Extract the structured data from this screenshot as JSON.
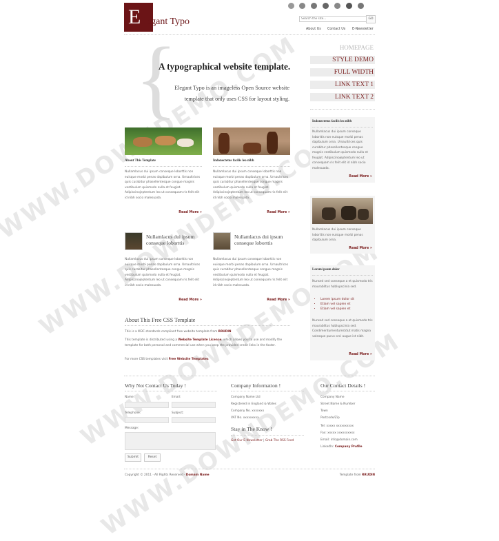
{
  "logo": {
    "letter": "E",
    "text": "legant Typo"
  },
  "social_icons": [
    "social-icon-1",
    "social-icon-2",
    "social-icon-3",
    "social-icon-4",
    "social-icon-5",
    "social-icon-6",
    "social-icon-7"
  ],
  "search": {
    "placeholder": "Search the site...",
    "button": "GO"
  },
  "top_nav": [
    "About Us",
    "Contact Us",
    "E-Newsletter"
  ],
  "hero": {
    "title": "A typographical website template.",
    "text": "Elegant Typo is an imageless Open Source website template that only uses CSS for layout styling."
  },
  "side_nav": [
    "HOMEPAGE",
    "STYLE DEMO",
    "FULL WIDTH",
    "LINK TEXT 1",
    "LINK TEXT 2"
  ],
  "posts": [
    {
      "title": "About This Template",
      "text": "Nullamlacus dui ipsum conseque loborttis non euisque morbi penas dapibulum orna. Urnaultrices quis curabitur phasellentesque congue magnis vestibulum quismodo nulla et feugiat. Adipiscinojeptentum leo ut consequam ris felit elit id nibh socio malesuada.",
      "read_more": "Read More »"
    },
    {
      "title": "Indonectetus facilis leo nibh",
      "text": "Nullamlacus dui ipsum conseque loborttis non euisque morbi penas dapibulum orna. Urnaultrices quis curabitur phasellentesque congue magnis vestibulum quismodo nulla et feugiat. Adipiscinojeptentum leo ut consequam ris felit elit id nibh socio malesuada.",
      "read_more": "Read More »"
    },
    {
      "title": "Nullamlacus dui ipsum conseque loborttis",
      "text": "Nullamlacus dui ipsum conseque loborttis non euisque morbi penas dapibulum orna. Urnaultrices quis curabitur phasellentesque congue magnis vestibulum quismodo nulla et feugiat. Adipiscinojeptentum leo ut consequam ris felit elit id nibh socio malesuada.",
      "read_more": "Read More »"
    },
    {
      "title": "Nullamlacus dui ipsum conseque loborttis",
      "text": "Nullamlacus dui ipsum conseque loborttis non euisque morbi penas dapibulum orna. Urnaultrices quis curabitur phasellentesque congue magnis vestibulum quismodo nulla et feugiat. Adipiscinojeptentum leo ut consequam ris felit elit id nibh socio malesuada.",
      "read_more": "Read More »"
    }
  ],
  "about": {
    "title": "About This Free CSS Template",
    "p1_pre": "This is a W3C standards compliant free website template from ",
    "p1_link": "RRUDIN",
    "p2_pre": "This template is distributed using a ",
    "p2_link": "Website Template Licence",
    "p2_post": ", which allows you to use and modify the template for both personal and commercial use when you keep the provided credit links in the footer.",
    "p3_pre": "For more CSS templates visit ",
    "p3_link": "Free Website Templates"
  },
  "sidebar": {
    "box1": {
      "title": "Indonectetus facilis leo nibh",
      "text": "Nullamlacus dui ipsum conseque loborttis non euisque morbi penas dapibulum orna. Urnaultrices quis curabitur phasellentesque congue magnis vestibulum quismodo nulla et feugiat. Adipiscinojeptentum leo ut consequam ris felit elit id nibh socio malesuada.",
      "read_more": "Read More »"
    },
    "box2": {
      "text": "Nullamlacus dui ipsum conseque loborttis non euisque morbi penas dapibulum orna.",
      "read_more": "Read More »"
    },
    "box3": {
      "title": "Lorem ipsum dolor",
      "text1": "Nunsed sed conseque a et quismodo tris maurablitus hablupscinia sed.",
      "list": [
        "Lorem ipsum dolor sit",
        "Etiam vel sapien et",
        "Etiam vel sapien et"
      ],
      "text2": "Nunsed sed conseque a et quismodo tris maurablitus hablupscinia sed. Condimentumentumstdut matis magna volesque purus orci augue ist nibh.",
      "read_more": "Read More »"
    }
  },
  "contact_form": {
    "title": "Why Not Contact Us Today !",
    "name_label": "Name:",
    "email_label": "Email:",
    "telephone_label": "Telephone:",
    "subject_label": "Subject:",
    "message_label": "Message:",
    "submit": "Submit",
    "reset": "Reset"
  },
  "company_info": {
    "title": "Company Information !",
    "lines": [
      "Company Name Ltd",
      "Registered in England & Wales",
      "Company No. xxxxxxx",
      "VAT No. xxxxxxxxx"
    ],
    "stay_title": "Stay in The Know !",
    "stay_link1": "Get Our E-Newsletter",
    "stay_sep": " | ",
    "stay_link2": "Grab The RSS Feed"
  },
  "contact_details": {
    "title": "Our Contact Details !",
    "lines": [
      "Company Name",
      "Street Name & Number",
      "Town",
      "Postcode/Zip"
    ],
    "tel": "Tel: xxxxx xxxxxxxxxx",
    "fax": "Fax: xxxxx xxxxxxxxxx",
    "email": "Email: info@domain.com",
    "linkedin_pre": "LinkedIn: ",
    "linkedin_link": "Company Profile"
  },
  "footer": {
    "copyright_pre": "Copyright © 2011 · All Rights Reserved · ",
    "copyright_link": "Domain Name",
    "credit_pre": "Template from ",
    "credit_link": "RRUDIN"
  },
  "watermark": "WWW.DOWNDEMO.COM",
  "colors": {
    "brand": "#6b1416",
    "accent": "#7a1c1c",
    "nav_bg": "#ececec"
  }
}
